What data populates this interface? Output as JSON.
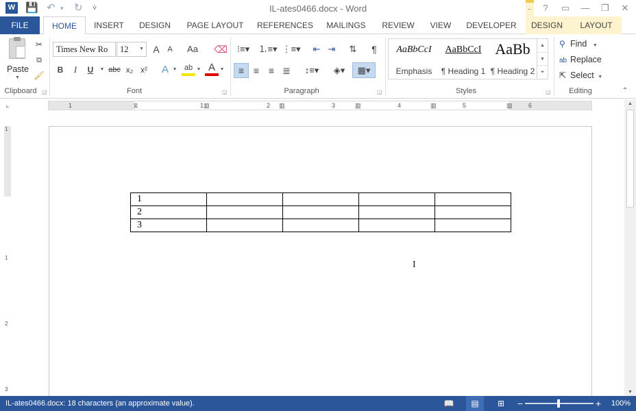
{
  "window": {
    "title": "IL-ates0466.docx - Word",
    "app_icon_letter": "W",
    "context_marker": "..",
    "help": "?",
    "restore_ribbon": "▭",
    "minimize": "—",
    "restore": "❐",
    "close": "✕"
  },
  "qat": {
    "save_icon": "💾",
    "undo_icon": "↶",
    "undo_dropdown": "▾",
    "redo_icon": "↻",
    "customize_icon": "⩒"
  },
  "tabs": [
    "FILE",
    "HOME",
    "INSERT",
    "DESIGN",
    "PAGE LAYOUT",
    "REFERENCES",
    "MAILINGS",
    "REVIEW",
    "VIEW",
    "DEVELOPER",
    "DESIGN",
    "LAYOUT"
  ],
  "clipboard": {
    "paste_label": "Paste",
    "group_label": "Clipboard"
  },
  "font": {
    "font_name": "Times New Ro",
    "font_size": "12",
    "group_label": "Font",
    "bold": "B",
    "italic": "I",
    "underline": "U",
    "strikethrough": "abc",
    "subscript": "x₂",
    "superscript": "x²",
    "grow": "A",
    "shrink": "A",
    "change_case": "Aa",
    "text_effects": "A",
    "font_color": "A",
    "highlight": "ab"
  },
  "paragraph": {
    "group_label": "Paragraph",
    "show_marks": "¶"
  },
  "styles": {
    "group_label": "Styles",
    "items": [
      {
        "preview": "AaBbCcI",
        "name": "Emphasis"
      },
      {
        "preview": "AaBbCcI",
        "name": "¶ Heading 1"
      },
      {
        "preview": "AaBb",
        "name": "¶ Heading 2"
      }
    ]
  },
  "editing": {
    "group_label": "Editing",
    "find": "Find",
    "replace": "Replace",
    "select": "Select"
  },
  "ruler": {
    "h_numbers": [
      "1",
      "1",
      "2",
      "3",
      "4",
      "5",
      "6"
    ],
    "v_numbers": [
      "1",
      "1",
      "2",
      "3"
    ]
  },
  "document": {
    "table": [
      [
        "1",
        "",
        "",
        "",
        ""
      ],
      [
        "2",
        "",
        "",
        "",
        ""
      ],
      [
        "3",
        "",
        "",
        "",
        ""
      ]
    ]
  },
  "status": {
    "text": "IL-ates0466.docx: 18 characters (an approximate value).",
    "zoom": "100%",
    "zoom_minus": "−",
    "zoom_plus": "+"
  },
  "colors": {
    "brand": "#2b579a",
    "context_tab": "#fdf3cf"
  }
}
